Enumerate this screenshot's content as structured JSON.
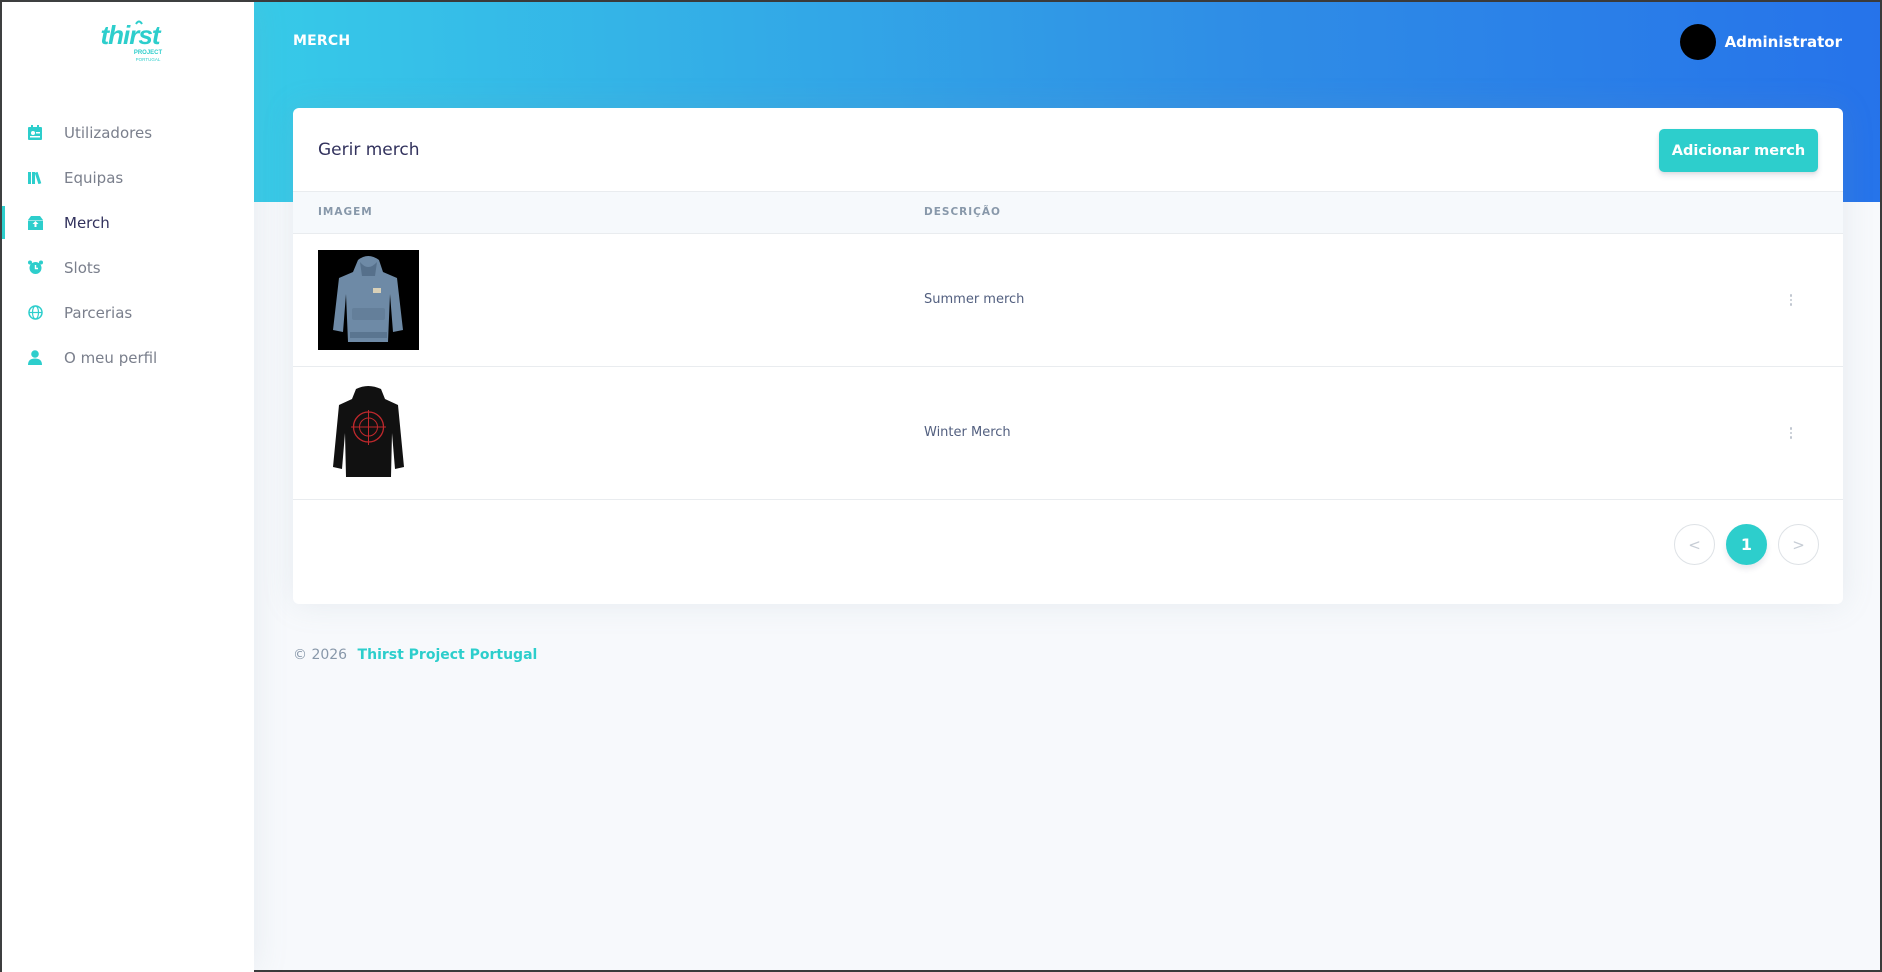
{
  "brand": {
    "logo_text": "thirst",
    "logo_sub1": "PROJECT",
    "logo_sub2": "PORTUGAL",
    "color": "#2dcecc"
  },
  "sidebar": {
    "items": [
      {
        "label": "Utilizadores",
        "icon": "id-card-icon",
        "active": false
      },
      {
        "label": "Equipas",
        "icon": "books-icon",
        "active": false
      },
      {
        "label": "Merch",
        "icon": "box-icon",
        "active": true
      },
      {
        "label": "Slots",
        "icon": "alarm-clock-icon",
        "active": false
      },
      {
        "label": "Parcerias",
        "icon": "globe-icon",
        "active": false
      },
      {
        "label": "O meu perfil",
        "icon": "user-icon",
        "active": false
      }
    ]
  },
  "header": {
    "title": "MERCH",
    "user_name": "Administrator",
    "gradient": [
      "#37cbe8",
      "#2673ea"
    ]
  },
  "card": {
    "title": "Gerir merch",
    "add_button": "Adicionar merch",
    "columns": [
      "IMAGEM",
      "DESCRIÇÃO"
    ],
    "rows": [
      {
        "image": "grey-hoodie-image",
        "description": "Summer merch"
      },
      {
        "image": "black-hoodie-image",
        "description": "Winter Merch"
      }
    ],
    "pagination": {
      "prev": "<",
      "current": "1",
      "next": ">"
    }
  },
  "footer": {
    "copyright": "© 2026",
    "link": "Thirst Project Portugal"
  }
}
